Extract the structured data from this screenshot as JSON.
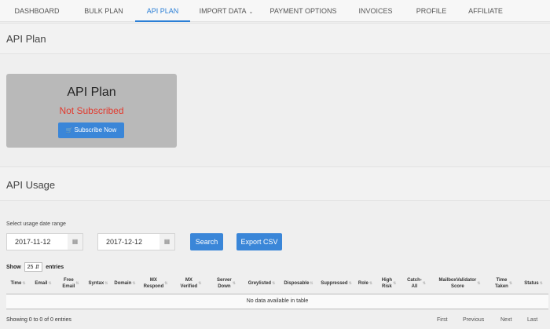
{
  "nav": {
    "items": [
      {
        "label": "DASHBOARD"
      },
      {
        "label": "BULK PLAN"
      },
      {
        "label": "API PLAN"
      },
      {
        "label": "IMPORT DATA"
      },
      {
        "label": "PAYMENT OPTIONS"
      },
      {
        "label": "INVOICES"
      },
      {
        "label": "PROFILE"
      },
      {
        "label": "AFFILIATE"
      }
    ],
    "active": "API PLAN"
  },
  "plan_section": {
    "title": "API Plan"
  },
  "plan_card": {
    "title": "API Plan",
    "status": "Not Subscribed",
    "subscribe_label": "Subscribe Now",
    "status_color": "#e23a2e"
  },
  "usage_section": {
    "title": "API Usage"
  },
  "filters": {
    "range_label": "Select usage date range",
    "start_date": "2017-11-12",
    "end_date": "2017-12-12",
    "search_label": "Search",
    "export_label": "Export CSV"
  },
  "table": {
    "show_label": "Show",
    "page_size": "25",
    "entries_label": "entries",
    "columns": [
      [
        "Time"
      ],
      [
        "Email"
      ],
      [
        "Free",
        "Email"
      ],
      [
        "Syntax"
      ],
      [
        "Domain"
      ],
      [
        "MX",
        "Respond"
      ],
      [
        "MX",
        "Verified"
      ],
      [
        "Server",
        "Down"
      ],
      [
        "Greylisted"
      ],
      [
        "Disposable"
      ],
      [
        "Suppressed"
      ],
      [
        "Role"
      ],
      [
        "High",
        "Risk"
      ],
      [
        "Catch-",
        "All"
      ],
      [
        "MailboxValidator",
        "Score"
      ],
      [
        "Time",
        "Taken"
      ],
      [
        "Status"
      ]
    ],
    "empty_message": "No data available in table",
    "info": "Showing 0 to 0 of 0 entries",
    "pager": {
      "first": "First",
      "previous": "Previous",
      "next": "Next",
      "last": "Last"
    }
  },
  "colors": {
    "accent": "#2b7fd6",
    "button": "#3a86d8",
    "card": "#b9b9b9"
  }
}
